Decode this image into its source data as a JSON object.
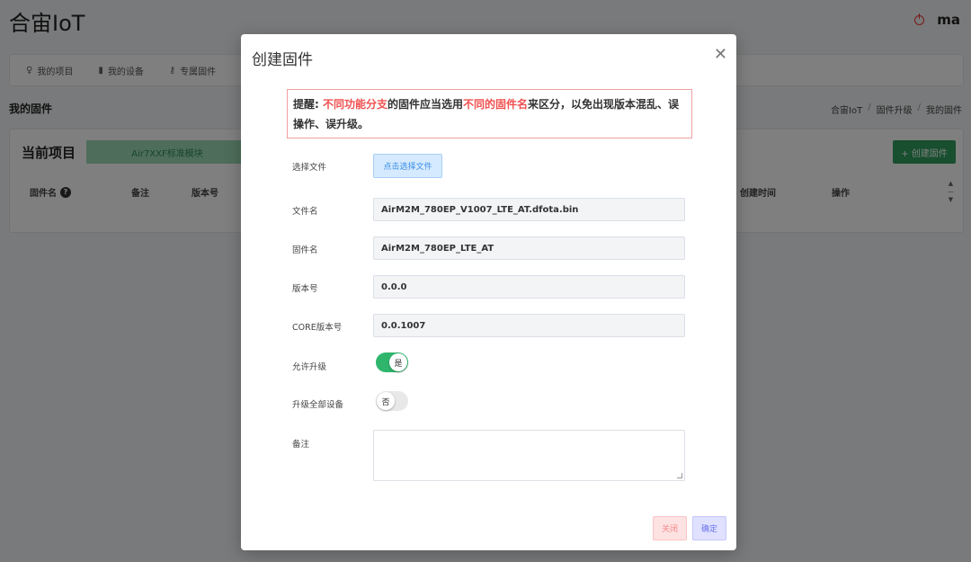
{
  "app": {
    "title": "合宙IoT",
    "user": "ma"
  },
  "nav": {
    "items": [
      {
        "label": "我的项目",
        "icon": "bulb-icon"
      },
      {
        "label": "我的设备",
        "icon": "device-icon"
      },
      {
        "label": "专属固件",
        "icon": "key-icon"
      }
    ]
  },
  "page": {
    "heading": "我的固件",
    "breadcrumb": [
      "合宙IoT",
      "固件升级",
      "我的固件"
    ],
    "breadcrumb_sep": "/"
  },
  "card": {
    "title": "当前项目",
    "project_tag": "Air7XXF标准模块",
    "create_button": "+ 创建固件",
    "columns": [
      "固件名",
      "备注",
      "版本号",
      "创建时间",
      "操作"
    ]
  },
  "modal": {
    "title": "创建固件",
    "warning": {
      "prefix": "提醒: ",
      "red1": "不同功能分支",
      "mid": "的固件应当选用",
      "red2": "不同的固件名",
      "suffix": "来区分，以免出现版本混乱、误操作、误升级。"
    },
    "select_file_label": "选择文件",
    "select_file_button": "点击选择文件",
    "file_name_label": "文件名",
    "file_name_value": "AirM2M_780EP_V1007_LTE_AT.dfota.bin",
    "firmware_name_label": "固件名",
    "firmware_name_value": "AirM2M_780EP_LTE_AT",
    "version_label": "版本号",
    "version_value": "0.0.0",
    "core_version_label": "CORE版本号",
    "core_version_value": "0.0.1007",
    "allow_upgrade_label": "允许升级",
    "allow_upgrade_state": "是",
    "upgrade_all_label": "升级全部设备",
    "upgrade_all_state": "否",
    "remark_label": "备注",
    "close_button": "关闭",
    "confirm_button": "确定"
  },
  "colors": {
    "accent_green": "#2fb66c",
    "warning_red": "#f05050"
  }
}
